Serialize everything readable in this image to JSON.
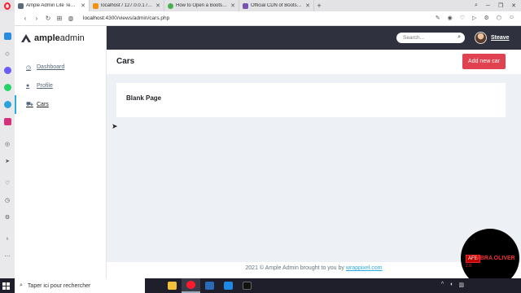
{
  "browser": {
    "tabs": [
      {
        "label": "Ample Admin Lite Templat",
        "icon_color": "#5b6b7b",
        "active": true
      },
      {
        "label": "localhost / 127.0.0.1 / car",
        "icon_color": "#f29111",
        "active": false
      },
      {
        "label": "How to Open a Bootstrap",
        "icon_color": "#4caf50",
        "active": false
      },
      {
        "label": "Official CDN of Bootstrap",
        "icon_color": "#7952b3",
        "active": false
      }
    ],
    "new_tab": "+",
    "url_host": "localhost",
    "url_path": ":4300/views/admin/cars.php"
  },
  "brand": {
    "bold": "ample",
    "light": "admin"
  },
  "sidebar": {
    "items": [
      {
        "label": "Dashboard",
        "icon": "clock-icon",
        "glyph": "◷"
      },
      {
        "label": "Profile",
        "icon": "user-icon",
        "glyph": "●"
      },
      {
        "label": "Cars",
        "icon": "car-icon",
        "glyph": "⛟"
      }
    ]
  },
  "header": {
    "search_placeholder": "Search...",
    "user_name": "Steave"
  },
  "page": {
    "title": "Cars",
    "add_button": "Add new car",
    "card_title": "Blank Page"
  },
  "footer": {
    "text": "2021 © Ample Admin brought to you by ",
    "link": "wrappixel.com"
  },
  "overlay": {
    "badge": "AFE",
    "text": "MBRA OLIVER",
    "sub": "2.0"
  },
  "taskbar": {
    "search_placeholder": "Taper ici pour rechercher"
  },
  "colors": {
    "accent": "#2cabe3",
    "topbar": "#2f323e",
    "danger": "#e0434f"
  }
}
